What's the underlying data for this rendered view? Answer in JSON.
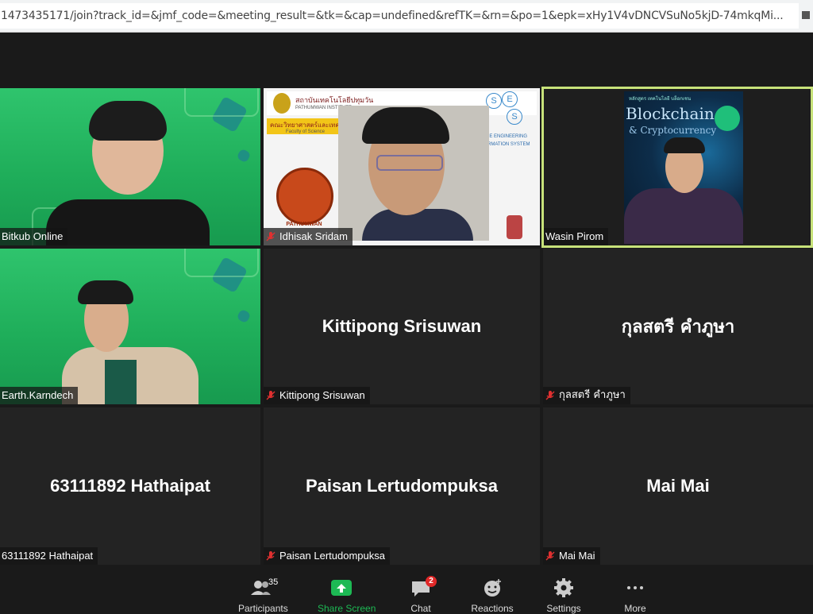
{
  "browser": {
    "url": "1473435171/join?track_id=&jmf_code=&meeting_result=&tk=&cap=undefined&refTK=&rn=&po=1&epk=xHy1V4vDNCVSuNo5kjD-74mkqMi..."
  },
  "tiles": [
    {
      "name": "Bitkub Online",
      "muted": false,
      "video": true
    },
    {
      "name": "Idhisak Sridam",
      "muted": true,
      "video": true
    },
    {
      "name": "Wasin Pirom",
      "muted": false,
      "video": true,
      "speaking": true
    },
    {
      "name": "Earth.Karndech",
      "muted": false,
      "video": true
    },
    {
      "name": "Kittipong Srisuwan",
      "muted": true,
      "video": false
    },
    {
      "name": "กุลสตรี คำภูษา",
      "muted": true,
      "video": false
    },
    {
      "name": "63111892 Hathaipat",
      "muted": false,
      "video": false
    },
    {
      "name": "Paisan Lertudompuksa",
      "muted": true,
      "video": false
    },
    {
      "name": "Mai Mai",
      "muted": true,
      "video": false
    }
  ],
  "slide": {
    "header_thai": "สถาบันเทคโนโลยีปทุมวัน",
    "header_en": "PATHUMWAN INSTITUTE",
    "sub_thai": "คณะวิทยาศาสตร์และเทคโนโลยี",
    "sub_en": "Faculty of Science",
    "logo_text": "PATHUMWAN",
    "ses_letters": [
      "S",
      "E",
      "S"
    ],
    "right_text_1": "ARE ENGINEERING",
    "right_text_2": "RMATION SYSTEM"
  },
  "background_slide": {
    "title": "Blockchain",
    "subtitle": "& Cryptocurrency",
    "top_text": "หลักสูตร เทคโนโลยี บล็อกเชน"
  },
  "toolbar": {
    "participants_count": "35",
    "chat_badge": "2",
    "items": [
      {
        "icon": "participants-icon",
        "label": "Participants"
      },
      {
        "icon": "share-screen-icon",
        "label": "Share Screen"
      },
      {
        "icon": "chat-icon",
        "label": "Chat"
      },
      {
        "icon": "reactions-icon",
        "label": "Reactions"
      },
      {
        "icon": "settings-icon",
        "label": "Settings"
      },
      {
        "icon": "more-icon",
        "label": "More"
      }
    ]
  },
  "colors": {
    "speaking_border": "#c7e27a",
    "tile_bg": "#232323",
    "green_bg": "#22b45f",
    "share_green": "#1db954",
    "badge_red": "#e02828"
  }
}
